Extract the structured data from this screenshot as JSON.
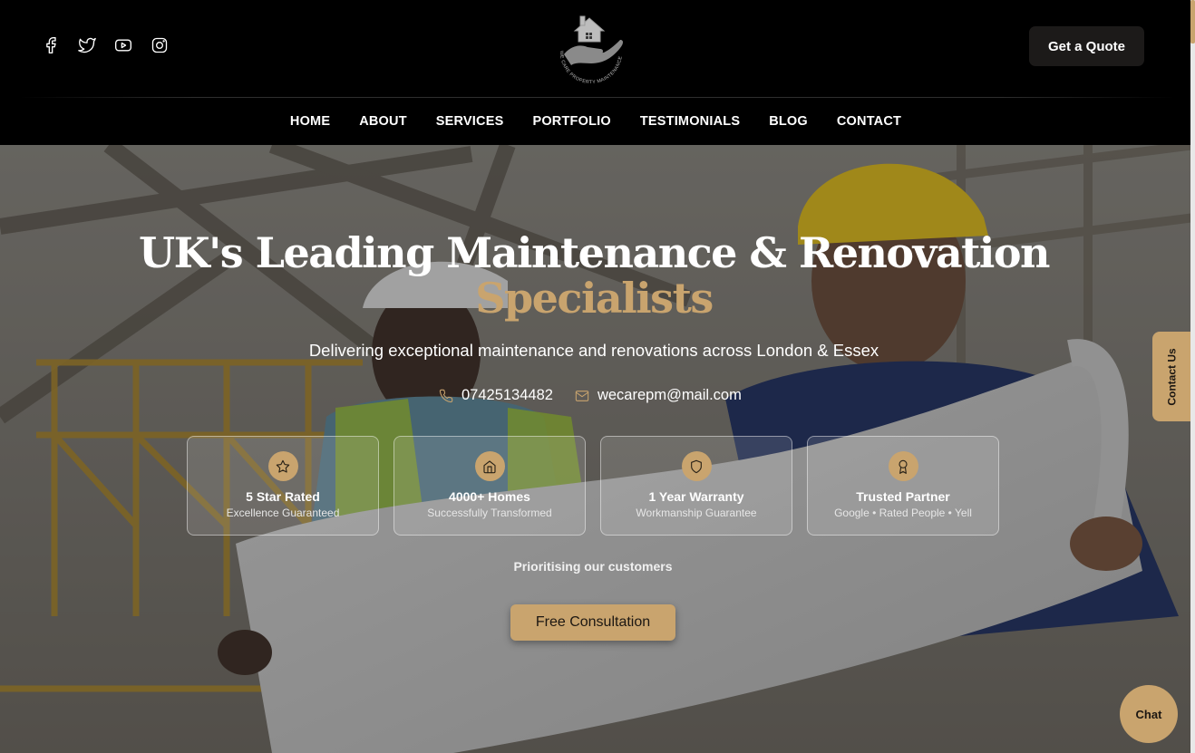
{
  "header": {
    "socials": [
      {
        "name": "facebook-icon"
      },
      {
        "name": "twitter-icon"
      },
      {
        "name": "youtube-icon"
      },
      {
        "name": "instagram-icon"
      }
    ],
    "logo_text": "WE CARE PROPERTY MAINTENANCE",
    "quote_label": "Get a Quote"
  },
  "nav": {
    "items": [
      "HOME",
      "ABOUT",
      "SERVICES",
      "PORTFOLIO",
      "TESTIMONIALS",
      "BLOG",
      "CONTACT"
    ]
  },
  "hero": {
    "headline_line1": "UK's Leading Maintenance & Renovation",
    "headline_line2": "Specialists",
    "subheadline": "Delivering exceptional maintenance and renovations across London & Essex",
    "phone": "07425134482",
    "email": "wecarepm@mail.com",
    "cards": [
      {
        "icon": "star-icon",
        "title": "5 Star Rated",
        "subtitle": "Excellence Guaranteed"
      },
      {
        "icon": "home-icon",
        "title": "4000+ Homes",
        "subtitle": "Successfully Transformed"
      },
      {
        "icon": "shield-icon",
        "title": "1 Year Warranty",
        "subtitle": "Workmanship Guarantee"
      },
      {
        "icon": "award-icon",
        "title": "Trusted Partner",
        "subtitle": "Google • Rated People • Yell"
      }
    ],
    "tagline": "Prioritising our customers",
    "cta_label": "Free Consultation"
  },
  "floating": {
    "contact_tab": "Contact Us",
    "chat_label": "Chat"
  },
  "colors": {
    "accent": "#c9a46e",
    "header_bg": "#000000",
    "button_dark": "#1c1a19"
  }
}
